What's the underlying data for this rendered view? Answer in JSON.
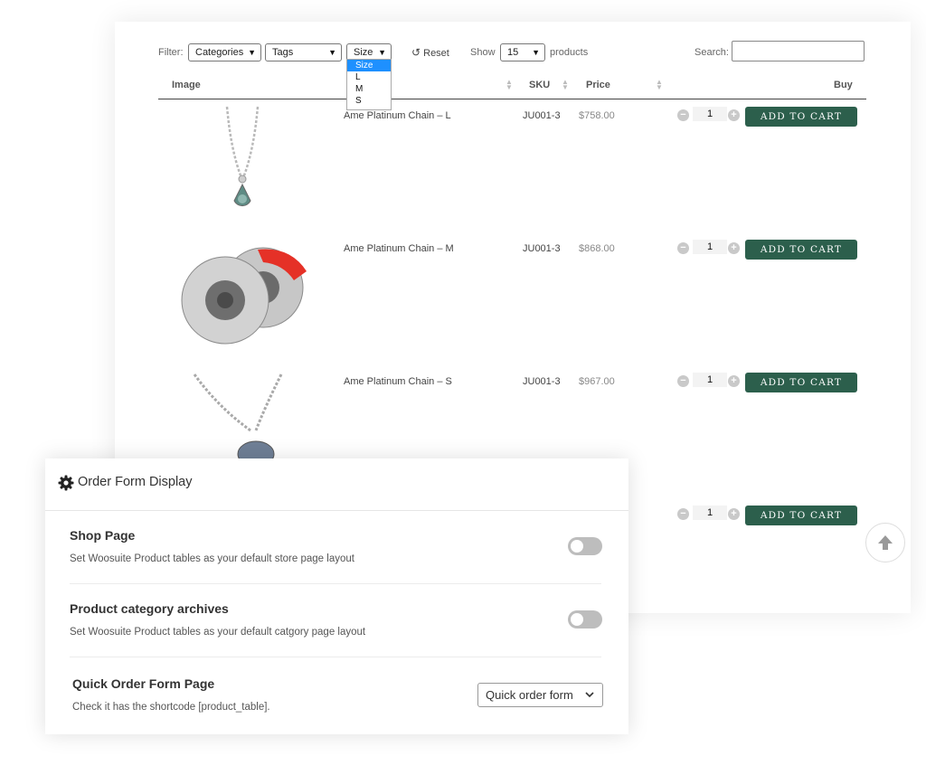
{
  "filters": {
    "label": "Filter:",
    "categories": "Categories",
    "tags": "Tags",
    "size": "Size",
    "reset": "Reset",
    "show_label": "Show",
    "show_value": "15",
    "products_label": "products",
    "search_label": "Search:",
    "search_value": "",
    "size_options": [
      "Size",
      "L",
      "M",
      "S"
    ]
  },
  "table": {
    "columns": [
      "Image",
      "SKU",
      "Price",
      "Buy"
    ],
    "rows": [
      {
        "name": "Ame Platinum Chain – L",
        "sku": "JU001-3",
        "price": "$758.00",
        "qty": "1"
      },
      {
        "name": "Ame Platinum Chain – M",
        "sku": "JU001-3",
        "price": "$868.00",
        "qty": "1"
      },
      {
        "name": "Ame Platinum Chain – S",
        "sku": "JU001-3",
        "price": "$967.00",
        "qty": "1"
      },
      {
        "name": "",
        "sku": "",
        "price": "",
        "qty": "1"
      }
    ],
    "add_to_cart": "ADD TO CART"
  },
  "panel": {
    "title": "Order Form Display",
    "shop_title": "Shop Page",
    "shop_desc": "Set Woosuite Product tables as your default store page layout",
    "category_title": "Product category archives",
    "category_desc": "Set Woosuite Product tables as your default catgory page layout",
    "quick_title": "Quick Order Form Page",
    "quick_desc": "Check it has the shortcode [product_table].",
    "quick_select": "Quick order form",
    "shop_enabled": false,
    "category_enabled": false
  },
  "colors": {
    "cart_button": "#2c5f4c",
    "highlight": "#1e90ff",
    "toggle_off": "#bdbdbd",
    "brake_caliper": "#e53127"
  },
  "icons": [
    "chevron-down-icon",
    "reset-icon",
    "sort-icon",
    "minus-icon",
    "plus-icon",
    "gear-icon",
    "arrow-up-icon"
  ]
}
